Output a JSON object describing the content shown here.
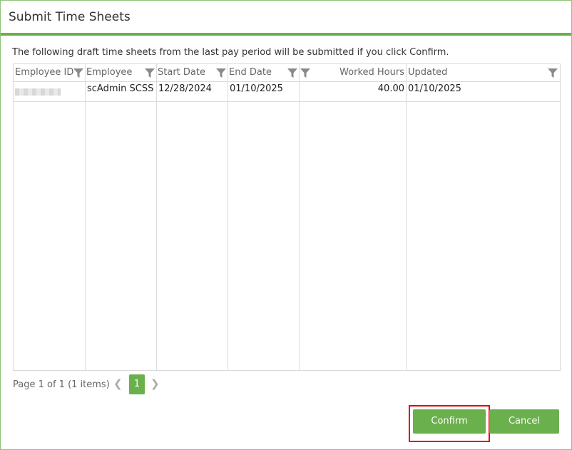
{
  "dialog": {
    "title": "Submit Time Sheets",
    "intro_text": "The following draft time sheets from the last pay period will be submitted if you click Confirm."
  },
  "grid": {
    "columns": [
      {
        "label": "Employee ID"
      },
      {
        "label": "Employee"
      },
      {
        "label": "Start Date"
      },
      {
        "label": "End Date"
      },
      {
        "label": "Worked Hours"
      },
      {
        "label": "Updated"
      }
    ],
    "rows": [
      {
        "employee_id": "",
        "employee": "scAdmin SCSS",
        "start_date": "12/28/2024",
        "end_date": "01/10/2025",
        "worked_hours": "40.00",
        "updated": "01/10/2025"
      }
    ]
  },
  "pager": {
    "summary": "Page 1 of 1 (1 items)",
    "current_page": "1",
    "prev_icon": "chevron-left-icon",
    "next_icon": "chevron-right-icon"
  },
  "buttons": {
    "confirm_label": "Confirm",
    "cancel_label": "Cancel"
  },
  "colors": {
    "accent": "#6ab04c",
    "highlight": "#e00000"
  }
}
